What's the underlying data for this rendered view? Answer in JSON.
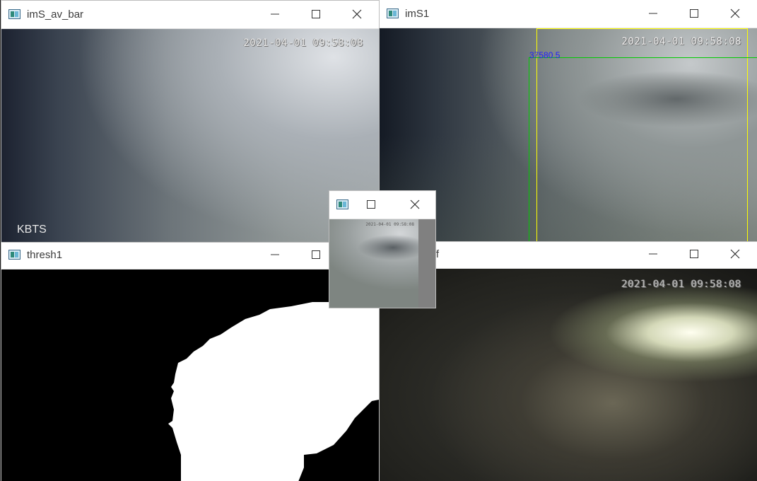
{
  "windows": {
    "av_bar": {
      "title": "imS_av_bar",
      "timestamp": "2021-04-01 09:58:08",
      "watermark": "KBTS"
    },
    "s1": {
      "title": "imS1",
      "timestamp": "2021-04-01 09:58:08",
      "area_label": "37580.5"
    },
    "thresh": {
      "title": "thresh1"
    },
    "diff": {
      "title": "ff",
      "timestamp": "2021-04-01 09:58:08"
    },
    "small": {
      "title": "",
      "timestamp": "2021-04-01 09:58:08"
    }
  },
  "icons": {
    "minimize": "minimize-icon",
    "maximize": "maximize-icon",
    "close": "close-icon",
    "app": "opencv-window-icon"
  },
  "colors": {
    "bounding_box_outer": "#ffff00",
    "bounding_box_inner": "#00cc00",
    "area_label": "#2020ff"
  }
}
